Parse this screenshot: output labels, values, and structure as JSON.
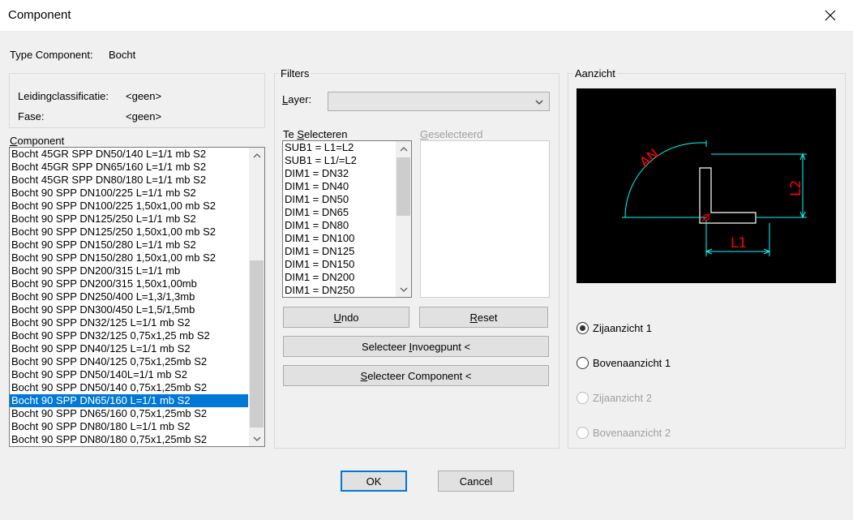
{
  "window": {
    "title": "Component"
  },
  "type_component": {
    "label": "Type Component:",
    "value": "Bocht"
  },
  "info": {
    "classification_label": "Leidingclassificatie:",
    "classification_value": "<geen>",
    "phase_label": "Fase:",
    "phase_value": "<geen>"
  },
  "component": {
    "label_first": "C",
    "label_rest": "omponent",
    "items": [
      "Bocht 45GR SPP DN50/140 L=1/1 mb S2",
      "Bocht 45GR SPP DN65/160 L=1/1 mb S2",
      "Bocht 45GR SPP DN80/180 L=1/1 mb S2",
      "Bocht 90 SPP DN100/225 L=1/1 mb S2",
      "Bocht 90 SPP DN100/225 1,50x1,00 mb S2",
      "Bocht 90 SPP DN125/250 L=1/1 mb S2",
      "Bocht 90 SPP DN125/250 1,50x1,00 mb S2",
      "Bocht 90 SPP DN150/280 L=1/1 mb S2",
      "Bocht 90 SPP DN150/280 1,50x1,00 mb S2",
      "Bocht 90 SPP DN200/315 L=1/1 mb",
      "Bocht 90 SPP DN200/315 1,50x1,00mb",
      "Bocht 90 SPP DN250/400 L=1,3/1,3mb",
      "Bocht 90 SPP DN300/450 L=1,5/1,5mb",
      "Bocht 90 SPP DN32/125 L=1/1 mb S2",
      "Bocht 90 SPP DN32/125 0,75x1,25 mb S2",
      "Bocht 90 SPP DN40/125 L=1/1 mb S2",
      "Bocht 90 SPP DN40/125 0,75x1,25mb S2",
      "Bocht 90 SPP DN50/140L=1/1 mb S2",
      "Bocht 90 SPP DN50/140 0,75x1,25mb S2",
      "Bocht 90 SPP DN65/160 L=1/1 mb S2",
      "Bocht 90 SPP DN65/160 0,75x1,25mb S2",
      "Bocht 90 SPP DN80/180 L=1/1 mb S2",
      "Bocht 90 SPP DN80/180 0,75x1,25mb S2"
    ],
    "selected_index": 19
  },
  "filters": {
    "title": "Filters",
    "layer_label_first": "L",
    "layer_label_rest": "ayer:",
    "layer_value": "",
    "te_selecteren_prefix": "Te ",
    "te_selecteren_first": "S",
    "te_selecteren_rest": "electeren",
    "te_selecteren_items": [
      "SUB1 = L1=L2",
      "SUB1 = L1/=L2",
      "DIM1 = DN32",
      "DIM1 = DN40",
      "DIM1 = DN50",
      "DIM1 = DN65",
      "DIM1 = DN80",
      "DIM1 = DN100",
      "DIM1 = DN125",
      "DIM1 = DN150",
      "DIM1 = DN200",
      "DIM1 = DN250"
    ],
    "geselecteerd_first": "G",
    "geselecteerd_rest": "eselecteerd"
  },
  "buttons": {
    "undo_first": "U",
    "undo_rest": "ndo",
    "reset_first": "R",
    "reset_rest": "eset",
    "invoegpunt_pre": "Selecteer ",
    "invoegpunt_first": "I",
    "invoegpunt_rest": "nvoegpunt <",
    "component_pre": "",
    "component_first": "S",
    "component_rest": "electeer Component <",
    "ok": "OK",
    "cancel": "Cancel"
  },
  "preview": {
    "title": "Aanzicht",
    "labels": {
      "an": "AN",
      "l1": "L1",
      "l2": "L2"
    },
    "colors": {
      "background": "#000000",
      "dimension": "#00ffff",
      "part": "#ffffff",
      "annotation": "#ff0000"
    }
  },
  "views": {
    "items": [
      {
        "label": "Zijaanzicht 1",
        "checked": true,
        "enabled": true
      },
      {
        "label": "Bovenaanzicht 1",
        "checked": false,
        "enabled": true
      },
      {
        "label": "Zijaanzicht 2",
        "checked": false,
        "enabled": false
      },
      {
        "label": "Bovenaanzicht 2",
        "checked": false,
        "enabled": false
      }
    ]
  }
}
